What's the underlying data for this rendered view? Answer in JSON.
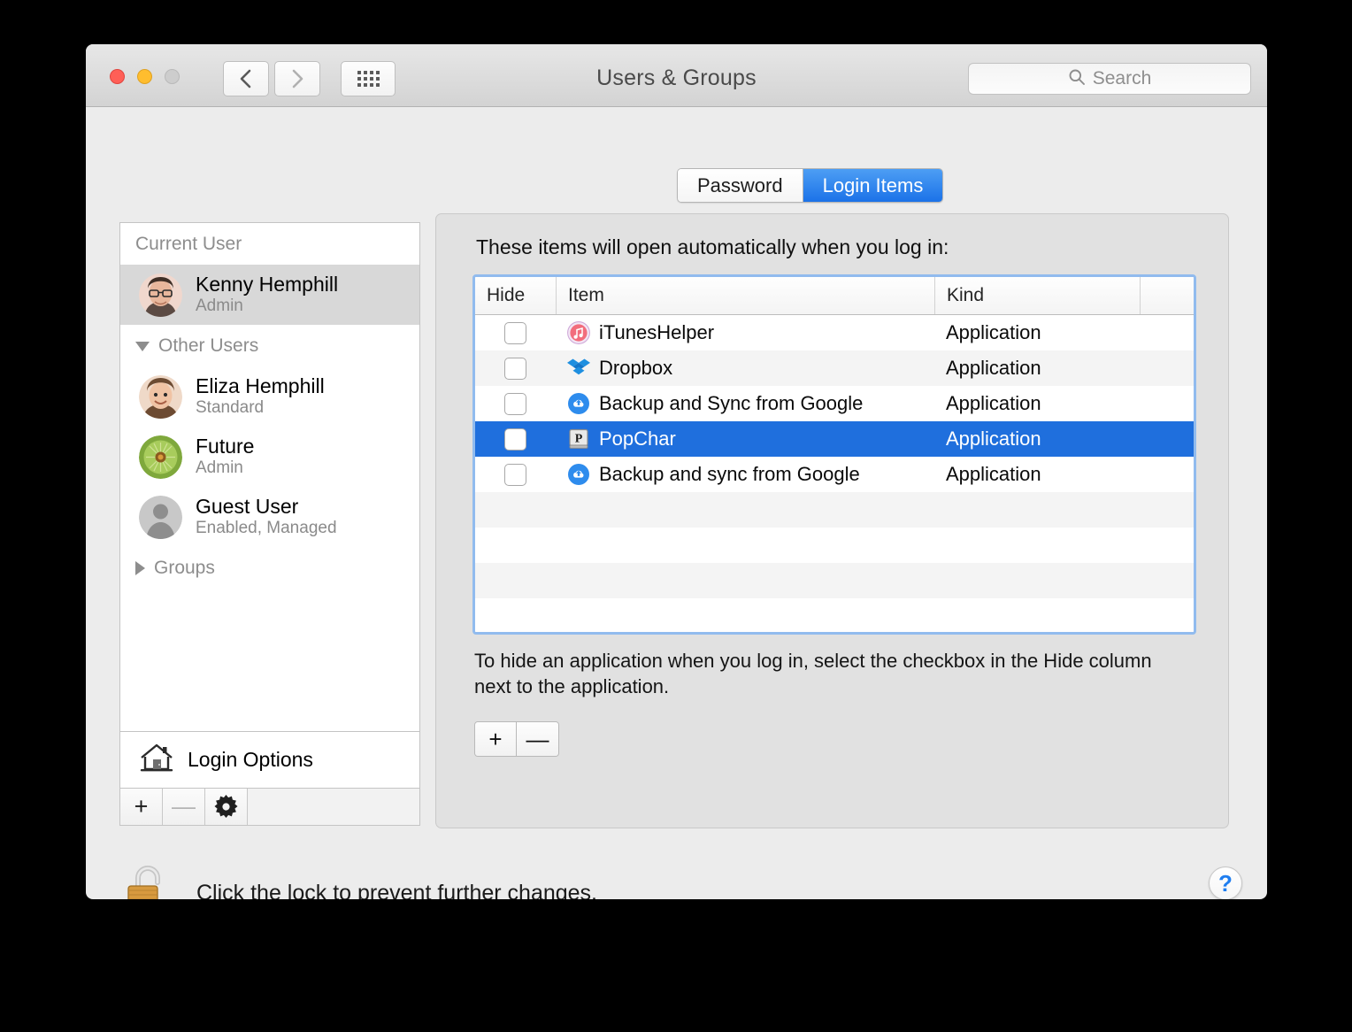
{
  "window": {
    "title": "Users & Groups",
    "traffic_lights": [
      "close",
      "minimize",
      "zoom"
    ],
    "nav_back": "back-chevron",
    "nav_forward": "forward-chevron",
    "grid_button": "show-all-icon"
  },
  "search": {
    "placeholder": "Search",
    "icon": "search-icon"
  },
  "sidebar": {
    "groups": [
      {
        "label": "Current User",
        "disclosure": "none",
        "users": [
          {
            "name": "Kenny Hemphill",
            "role": "Admin",
            "selected": true,
            "avatar": "photo-man-glasses"
          }
        ]
      },
      {
        "label": "Other Users",
        "disclosure": "expanded",
        "users": [
          {
            "name": "Eliza Hemphill",
            "role": "Standard",
            "selected": false,
            "avatar": "photo-child"
          },
          {
            "name": "Future",
            "role": "Admin",
            "selected": false,
            "avatar": "photo-kiwi"
          },
          {
            "name": "Guest User",
            "role": "Enabled, Managed",
            "selected": false,
            "avatar": "generic-person"
          }
        ]
      },
      {
        "label": "Groups",
        "disclosure": "collapsed",
        "users": []
      }
    ],
    "login_options": {
      "label": "Login Options",
      "icon": "house-icon"
    },
    "toolbar": {
      "add": "+",
      "remove": "—",
      "settings": "gear-icon",
      "remove_disabled": true
    }
  },
  "panel": {
    "tabs": [
      {
        "label": "Password",
        "active": false
      },
      {
        "label": "Login Items",
        "active": true
      }
    ],
    "intro": "These items will open automatically when you log in:",
    "table": {
      "columns": [
        "Hide",
        "Item",
        "Kind"
      ],
      "rows": [
        {
          "hide": false,
          "item": "iTunesHelper",
          "kind": "Application",
          "icon": "itunes-icon",
          "selected": false
        },
        {
          "hide": false,
          "item": "Dropbox",
          "kind": "Application",
          "icon": "dropbox-icon",
          "selected": false
        },
        {
          "hide": false,
          "item": "Backup and Sync from Google",
          "kind": "Application",
          "icon": "google-backup-icon",
          "selected": false
        },
        {
          "hide": false,
          "item": "PopChar",
          "kind": "Application",
          "icon": "popchar-icon",
          "selected": true
        },
        {
          "hide": false,
          "item": "Backup and sync from Google",
          "kind": "Application",
          "icon": "google-backup-icon",
          "selected": false
        }
      ],
      "empty_rows": 4
    },
    "hint": "To hide an application when you log in, select the checkbox in the Hide column next to the application.",
    "add_button": "+",
    "remove_button": "—"
  },
  "footer": {
    "lock_text": "Click the lock to prevent further changes.",
    "lock_icon": "unlocked-padlock-icon",
    "help_button": "?"
  },
  "colors": {
    "accent_blue": "#1f6fdd",
    "tab_blue": "#1b72e8",
    "focus_ring": "#91bbee",
    "help_blue": "#1f7ef0"
  }
}
